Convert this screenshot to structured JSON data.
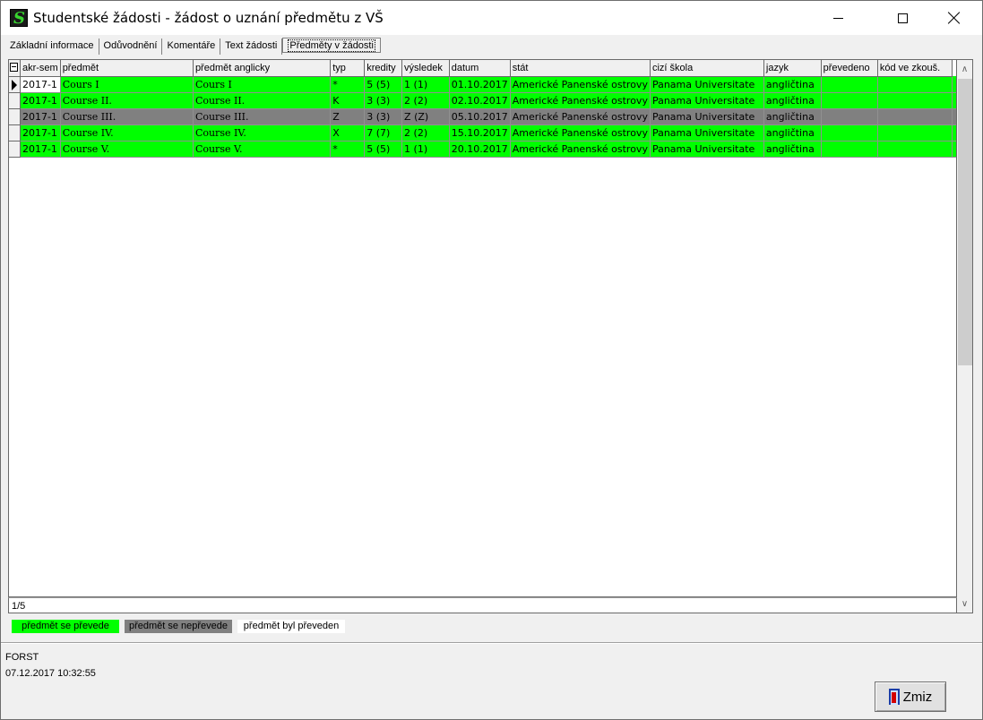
{
  "window": {
    "title": "Studentské žádosti - žádost o uznání předmětu z VŠ",
    "icon": "app-s-icon"
  },
  "tabs": [
    {
      "label": "Základní informace",
      "active": false
    },
    {
      "label": "Odůvodnění",
      "active": false
    },
    {
      "label": "Komentáře",
      "active": false
    },
    {
      "label": "Text žádosti",
      "active": false
    },
    {
      "label": "Předměty v žádosti",
      "active": true
    }
  ],
  "grid": {
    "columns": [
      "akr-sem",
      "předmět",
      "předmět anglicky",
      "typ",
      "kredity",
      "výsledek",
      "datum",
      "stát",
      "cizí škola",
      "jazyk",
      "převedeno",
      "kód ve zkouš."
    ],
    "rows": [
      {
        "status": "prevede",
        "current": true,
        "cells": [
          "2017-1",
          "Cours I",
          "Cours I",
          "*",
          "5 (5)",
          "1 (1)",
          "01.10.2017",
          "Americké Panenské ostrovy",
          "Panama Universitate",
          "angličtina",
          "",
          ""
        ]
      },
      {
        "status": "prevede",
        "current": false,
        "cells": [
          "2017-1",
          "Course II.",
          "Course II.",
          "K",
          "3 (3)",
          "2 (2)",
          "02.10.2017",
          "Americké Panenské ostrovy",
          "Panama Universitate",
          "angličtina",
          "",
          ""
        ]
      },
      {
        "status": "neprevede",
        "current": false,
        "cells": [
          "2017-1",
          "Course III.",
          "Course III.",
          "Z",
          "3 (3)",
          "Z (Z)",
          "05.10.2017",
          "Americké Panenské ostrovy",
          "Panama Universitate",
          "angličtina",
          "",
          ""
        ]
      },
      {
        "status": "prevede",
        "current": false,
        "cells": [
          "2017-1",
          "Course IV.",
          "Course IV.",
          "X",
          "7 (7)",
          "2 (2)",
          "15.10.2017",
          "Americké Panenské ostrovy",
          "Panama Universitate",
          "angličtina",
          "",
          ""
        ]
      },
      {
        "status": "prevede",
        "current": false,
        "cells": [
          "2017-1",
          "Course V.",
          "Course V.",
          "*",
          "5 (5)",
          "1 (1)",
          "20.10.2017",
          "Americké Panenské ostrovy",
          "Panama Universitate",
          "angličtina",
          "",
          ""
        ]
      }
    ],
    "record_position": "1/5"
  },
  "legend": [
    {
      "label": "předmět se převede",
      "color": "#00ff00"
    },
    {
      "label": "předmět se nepřevede",
      "color": "#808080"
    },
    {
      "label": "předmět byl převeden",
      "color": "#ffffff"
    }
  ],
  "colors": {
    "prevede": "#00ff00",
    "neprevede": "#808080",
    "prevedeno": "#ffffff"
  },
  "footer": {
    "user": "FORST",
    "timestamp": "07.12.2017 10:32:55",
    "close_button_label": "Zmiz",
    "close_button_icon": "door-exit-icon"
  }
}
